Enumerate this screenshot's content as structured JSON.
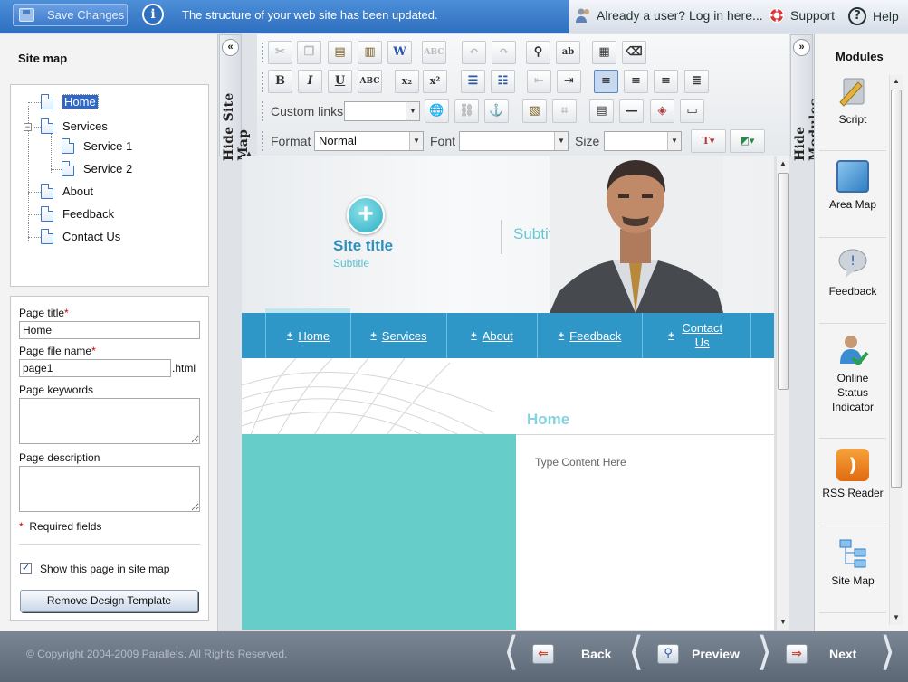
{
  "topbar": {
    "save_label": "Save Changes",
    "status_message": "The structure of your web site has been updated.",
    "login_label": "Already a user? Log in here...",
    "support_label": "Support",
    "help_label": "Help"
  },
  "sitemap": {
    "title": "Site map",
    "nodes": [
      {
        "label": "Home",
        "selected": true
      },
      {
        "label": "Services"
      },
      {
        "label": "Service 1"
      },
      {
        "label": "Service 2"
      },
      {
        "label": "About"
      },
      {
        "label": "Feedback"
      },
      {
        "label": "Contact Us"
      }
    ]
  },
  "props": {
    "page_title_label": "Page title",
    "page_title_value": "Home",
    "file_name_label": "Page file name",
    "file_name_value": "page1",
    "file_ext": ".html",
    "keywords_label": "Page keywords",
    "description_label": "Page description",
    "required_marker": "*",
    "required_note": "Required fields",
    "show_in_sitemap_label": "Show this page in site map",
    "show_in_sitemap_checked": true,
    "remove_template_label": "Remove Design Template"
  },
  "strips": {
    "hide_sitemap": "Hide Site Map",
    "hide_modules": "Hide Modules"
  },
  "toolbar": {
    "custom_links_label": "Custom links",
    "format_label": "Format",
    "format_value": "Normal",
    "font_label": "Font",
    "font_value": "",
    "size_label": "Size",
    "size_value": "",
    "row1_icons": [
      "cut-icon",
      "copy-icon",
      "paste-icon",
      "paste-text-icon",
      "paste-word-icon",
      "spellcheck-icon",
      "undo-icon",
      "redo-icon",
      "find-icon",
      "replace-icon",
      "select-all-icon",
      "remove-format-icon"
    ],
    "bold": "B",
    "italic": "I",
    "underline": "U",
    "strike": "ABC",
    "subscript": "x₂",
    "superscript": "x²"
  },
  "page": {
    "site_title": "Site title",
    "site_subtitle_small": "Subtitle",
    "subtitle": "Subtitle",
    "nav": [
      "Home",
      "Services",
      "About",
      "Feedback",
      "Contact Us"
    ],
    "home_heading": "Home",
    "content_placeholder": "Type Content Here"
  },
  "modules": {
    "title": "Modules",
    "items": [
      {
        "label": "Script",
        "icon": "script-icon"
      },
      {
        "label": "Area Map",
        "icon": "area-map-icon"
      },
      {
        "label": "Feedback",
        "icon": "feedback-icon"
      },
      {
        "label": "Online Status Indicator",
        "icon": "online-status-icon"
      },
      {
        "label": "RSS Reader",
        "icon": "rss-icon"
      },
      {
        "label": "Site Map",
        "icon": "site-map-icon"
      }
    ]
  },
  "bottom": {
    "copyright": "© Copyright 2004-2009 Parallels. All Rights Reserved.",
    "back_label": "Back",
    "preview_label": "Preview",
    "next_label": "Next"
  },
  "colors": {
    "topbar": "#2f6fc0",
    "nav_blue": "#2f97c8",
    "teal": "#67cdc9",
    "bottombar": "#5c6775"
  }
}
